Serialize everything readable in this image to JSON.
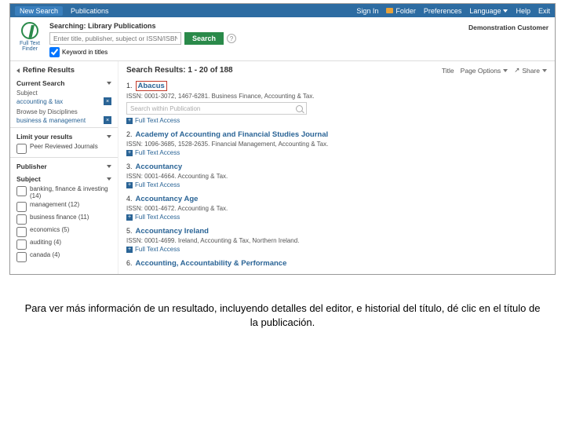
{
  "topbar": {
    "new_search": "New Search",
    "publications": "Publications",
    "signin": "Sign In",
    "folder": "Folder",
    "preferences": "Preferences",
    "language": "Language",
    "help": "Help",
    "exit": "Exit"
  },
  "header": {
    "logo_line1": "Full Text",
    "logo_line2": "Finder",
    "searching_label": "Searching: Library Publications",
    "placeholder": "Enter title, publisher, subject or ISSN/ISBN",
    "search_btn": "Search",
    "keyword_label": "Keyword in titles",
    "demo": "Demonstration Customer"
  },
  "sidebar": {
    "refine": "Refine Results",
    "current_search": "Current Search",
    "subject_label": "Subject",
    "subject_value": "accounting & tax",
    "browse_label": "Browse by Disciplines",
    "browse_value": "business & management",
    "limit_head": "Limit your results",
    "peer": "Peer Reviewed Journals",
    "publisher_head": "Publisher",
    "subject_head": "Subject",
    "facets": [
      "banking, finance & investing (14)",
      "management (12)",
      "business finance (11)",
      "economics (5)",
      "auditing (4)",
      "canada (4)"
    ]
  },
  "results": {
    "heading": "Search Results: 1 - 20 of 188",
    "title_tool": "Title",
    "page_options": "Page Options",
    "share": "Share",
    "search_within_placeholder": "Search within Publication",
    "access": "Full Text Access",
    "items": [
      {
        "n": "1",
        "title": "Abacus",
        "meta": "ISSN: 0001-3072, 1467-6281. Business Finance, Accounting & Tax.",
        "highlight": true,
        "searchWithin": true
      },
      {
        "n": "2",
        "title": "Academy of Accounting and Financial Studies Journal",
        "meta": "ISSN: 1096-3685, 1528-2635. Financial Management, Accounting & Tax."
      },
      {
        "n": "3",
        "title": "Accountancy",
        "meta": "ISSN: 0001-4664. Accounting & Tax."
      },
      {
        "n": "4",
        "title": "Accountancy Age",
        "meta": "ISSN: 0001-4672. Accounting & Tax."
      },
      {
        "n": "5",
        "title": "Accountancy Ireland",
        "meta": "ISSN: 0001-4699. Ireland, Accounting & Tax, Northern Ireland."
      },
      {
        "n": "6",
        "title": "Accounting, Accountability & Performance",
        "meta": ""
      }
    ]
  },
  "caption": "Para ver más información de un resultado, incluyendo detalles del editor, e historial del título, dé clic en el título de la publicación."
}
